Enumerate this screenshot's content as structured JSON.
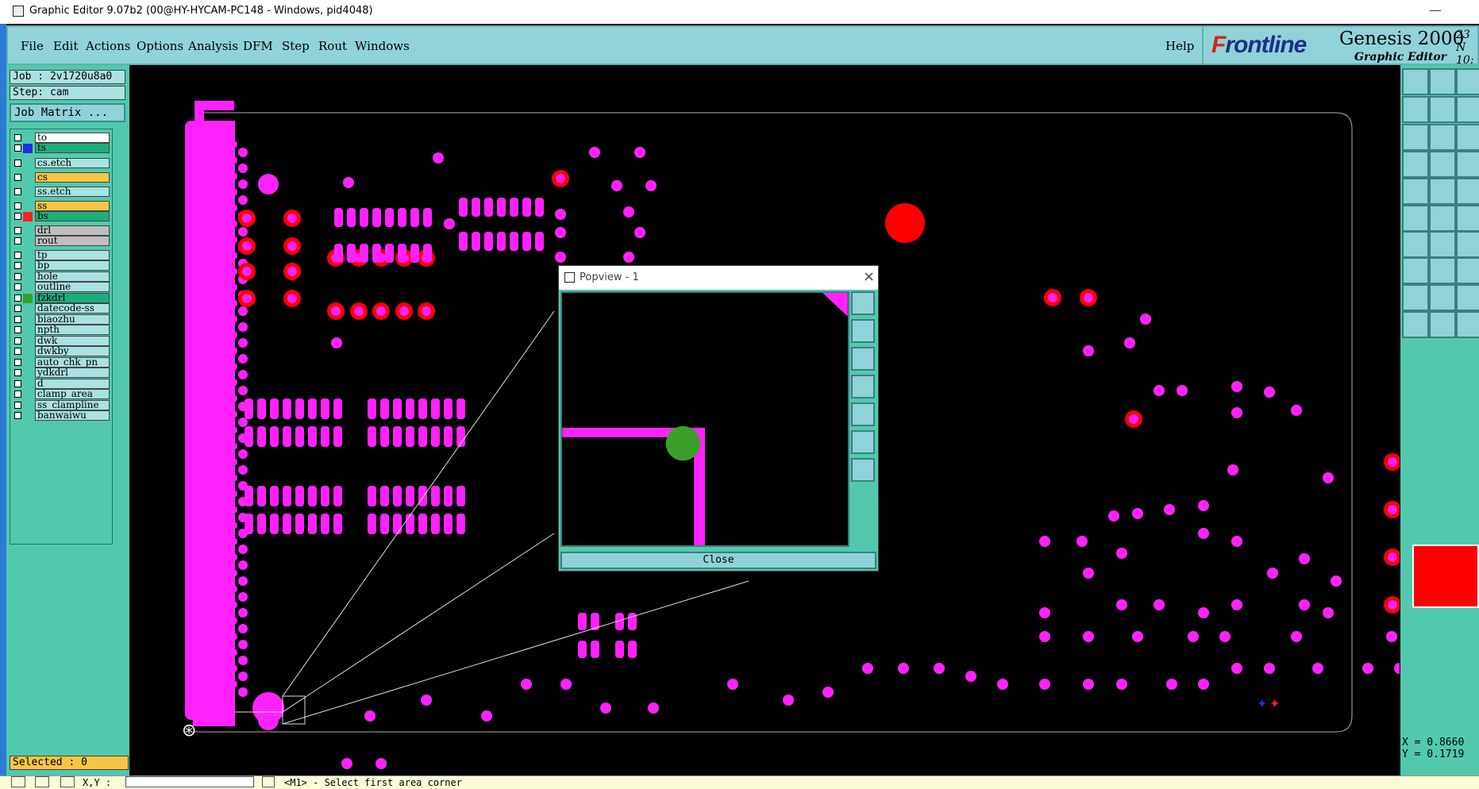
{
  "window": {
    "title": "Graphic Editor 9.07b2 (00@HY-HYCAM-PC148 - Windows, pid4048)",
    "minimize": "—"
  },
  "menu": {
    "items": [
      "File",
      "Edit",
      "Actions",
      "Options",
      "Analysis",
      "DFM",
      "Step",
      "Rout",
      "Windows"
    ],
    "help": "Help"
  },
  "brand": {
    "logo_f": "F",
    "logo_rest": "rontline",
    "product": "Genesis 2000",
    "subtitle": "Graphic Editor",
    "date": "23 N",
    "time": "10:"
  },
  "job": {
    "job_label": "Job : 2v1720u8a0",
    "step_label": "Step: cam",
    "matrix_button": "Job Matrix ..."
  },
  "layers": [
    {
      "name": "to",
      "color": "#ffffff"
    },
    {
      "name": "ts",
      "color": "#1dae7e",
      "swatch": "#1f2fe0"
    },
    {
      "name": "cs.etch",
      "color": "#a9e2e2"
    },
    {
      "name": "cs",
      "color": "#f7c545"
    },
    {
      "name": "ss.etch",
      "color": "#a9e2e2"
    },
    {
      "name": "ss",
      "color": "#f7c545"
    },
    {
      "name": "bs",
      "color": "#1dae7e",
      "swatch": "#ff2020"
    },
    {
      "name": "drl",
      "color": "#bfbfbf"
    },
    {
      "name": "rout",
      "color": "#bfbfbf"
    },
    {
      "name": "tp",
      "color": "#a9e2e2"
    },
    {
      "name": "bp",
      "color": "#a9e2e2"
    },
    {
      "name": "hole",
      "color": "#a9e2e2"
    },
    {
      "name": "outline",
      "color": "#a9e2e2"
    },
    {
      "name": "fzkdrl",
      "color": "#1dae7e",
      "swatch": "#3aa02a"
    },
    {
      "name": "datecode-ss",
      "color": "#a9e2e2"
    },
    {
      "name": "biaozhu",
      "color": "#a9e2e2"
    },
    {
      "name": "npth",
      "color": "#a9e2e2"
    },
    {
      "name": "dwk",
      "color": "#a9e2e2"
    },
    {
      "name": "dwkby",
      "color": "#a9e2e2"
    },
    {
      "name": "auto_chk_pn",
      "color": "#a9e2e2"
    },
    {
      "name": "ydkdrl",
      "color": "#a9e2e2"
    },
    {
      "name": "d",
      "color": "#a9e2e2"
    },
    {
      "name": "clamp_area",
      "color": "#a9e2e2"
    },
    {
      "name": "ss_clampline",
      "color": "#a9e2e2"
    },
    {
      "name": "banwaiwu",
      "color": "#a9e2e2"
    }
  ],
  "selected_label": "Selected : 0",
  "coords": {
    "x": "X = 0.8660",
    "y": "Y = 0.1719"
  },
  "status": {
    "xy_label": "X,Y :",
    "message": "<M1> - Select first area corner"
  },
  "popview": {
    "title": "Popview - 1",
    "close_label": "Close"
  },
  "colors": {
    "panel": "#52c9ad",
    "menu": "#8fd3d8",
    "pad_magenta": "#ff22ff",
    "pad_red": "#ff0000",
    "drill_blue": "#1f2fe0",
    "accent_green": "#3aa02a"
  }
}
